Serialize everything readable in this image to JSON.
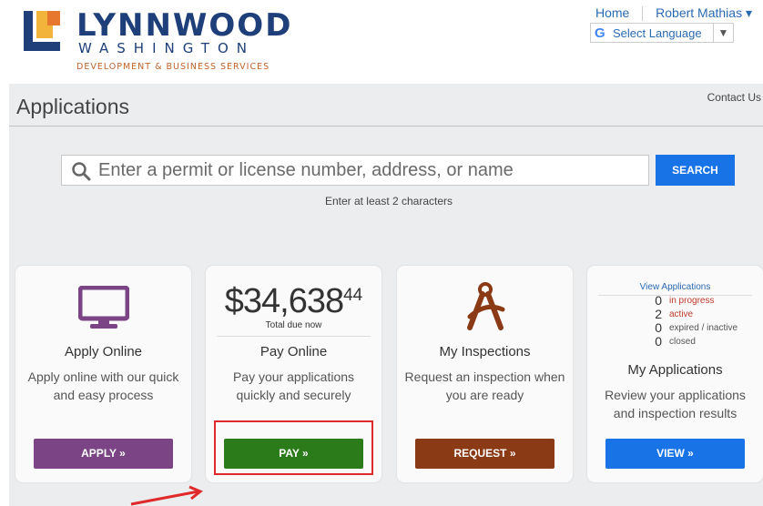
{
  "header": {
    "logo_title": "LYNNWOOD",
    "logo_sub": "WASHINGTON",
    "logo_dept": "DEVELOPMENT & BUSINESS SERVICES",
    "nav_home": "Home",
    "nav_user": "Robert Mathias ▾",
    "lang_label": "Select Language",
    "lang_arrow": "▼"
  },
  "page": {
    "title": "Applications",
    "contact": "Contact Us"
  },
  "search": {
    "placeholder": "Enter a permit or license number, address, or name",
    "button": "SEARCH",
    "hint": "Enter at least 2 characters"
  },
  "cards": {
    "apply": {
      "title": "Apply Online",
      "desc": "Apply online with our quick and easy process",
      "button": "APPLY »",
      "button_color": "#7b4585"
    },
    "pay": {
      "amount": "$34,638",
      "cents": "44",
      "total_label": "Total due now",
      "title": "Pay Online",
      "desc": "Pay your applications quickly and securely",
      "button": "PAY »",
      "button_color": "#2b7b1a"
    },
    "inspections": {
      "title": "My Inspections",
      "desc": "Request an inspection when you are ready",
      "button": "REQUEST »",
      "button_color": "#8b3a16"
    },
    "applications": {
      "view_link": "View Applications",
      "stats": [
        {
          "num": "0",
          "label": "in progress",
          "color": "#c0392b"
        },
        {
          "num": "2",
          "label": "active",
          "color": "#c0392b"
        },
        {
          "num": "0",
          "label": "expired / inactive",
          "color": "#555555"
        },
        {
          "num": "0",
          "label": "closed",
          "color": "#555555"
        }
      ],
      "title": "My Applications",
      "desc": "Review your applications and inspection results",
      "button": "VIEW »",
      "button_color": "#1773e6"
    }
  }
}
